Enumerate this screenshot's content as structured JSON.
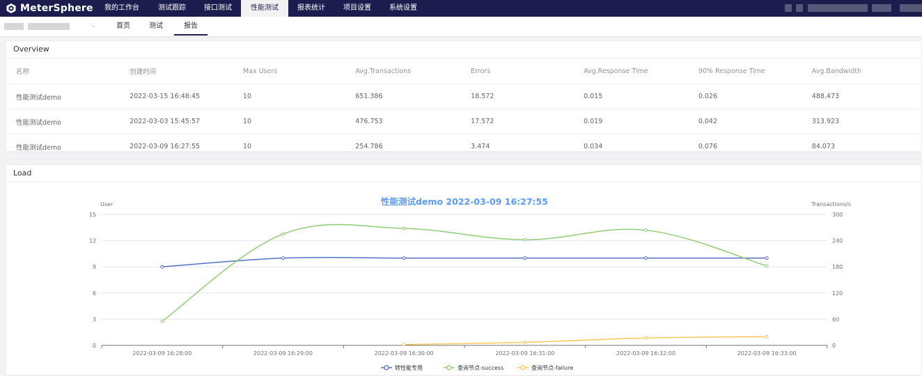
{
  "app": {
    "name": "MeterSphere"
  },
  "nav": [
    {
      "label": "我的工作台"
    },
    {
      "label": "测试跟踪"
    },
    {
      "label": "接口测试"
    },
    {
      "label": "性能测试",
      "active": true
    },
    {
      "label": "报表统计"
    },
    {
      "label": "项目设置"
    },
    {
      "label": "系统设置"
    }
  ],
  "subtabs": [
    {
      "label": "首页"
    },
    {
      "label": "测试"
    },
    {
      "label": "报告",
      "active": true
    }
  ],
  "overview": {
    "title": "Overview",
    "columns": [
      "名称",
      "创建时间",
      "Max Users",
      "Avg.Transactions",
      "Errors",
      "Avg.Response Time",
      "90% Response Time",
      "Avg.Bandwidth"
    ],
    "rows": [
      [
        "性能测试demo",
        "2022-03-15 16:48:45",
        "10",
        "651.386",
        "18.572",
        "0.015",
        "0.026",
        "488.473"
      ],
      [
        "性能测试demo",
        "2022-03-03 15:45:57",
        "10",
        "476.753",
        "17.572",
        "0.019",
        "0.042",
        "313.923"
      ],
      [
        "性能测试demo",
        "2022-03-09 16:27:55",
        "10",
        "254.786",
        "3.474",
        "0.034",
        "0.076",
        "84.073"
      ]
    ]
  },
  "load": {
    "title": "Load",
    "colors": {
      "users": "#5470c6",
      "success": "#91cc75",
      "failure": "#fac858"
    }
  },
  "chart_data": {
    "type": "line",
    "title": "性能测试demo 2022-03-09 16:27:55",
    "x": [
      "2022-03-09 16:28:00",
      "2022-03-09 16:29:00",
      "2022-03-09 16:30:00",
      "2022-03-09 16:31:00",
      "2022-03-09 16:32:00",
      "2022-03-09 16:33:00"
    ],
    "y_left": {
      "label": "User",
      "range": [
        0,
        15
      ],
      "ticks": [
        0,
        3,
        6,
        9,
        12,
        15
      ]
    },
    "y_right": {
      "label": "Transactions/s",
      "range": [
        0,
        300
      ],
      "ticks": [
        0,
        60,
        120,
        180,
        240,
        300
      ]
    },
    "series": [
      {
        "name": "转性能专用",
        "axis": "left",
        "values": [
          9,
          10,
          10,
          10,
          10,
          10
        ]
      },
      {
        "name": "查询节点-success",
        "axis": "right",
        "values": [
          55,
          255,
          268,
          242,
          264,
          182
        ]
      },
      {
        "name": "查询节点-failure",
        "axis": "right",
        "values": [
          null,
          null,
          2,
          7,
          17,
          20
        ]
      }
    ],
    "grid": true,
    "legend": "bottom-center"
  }
}
